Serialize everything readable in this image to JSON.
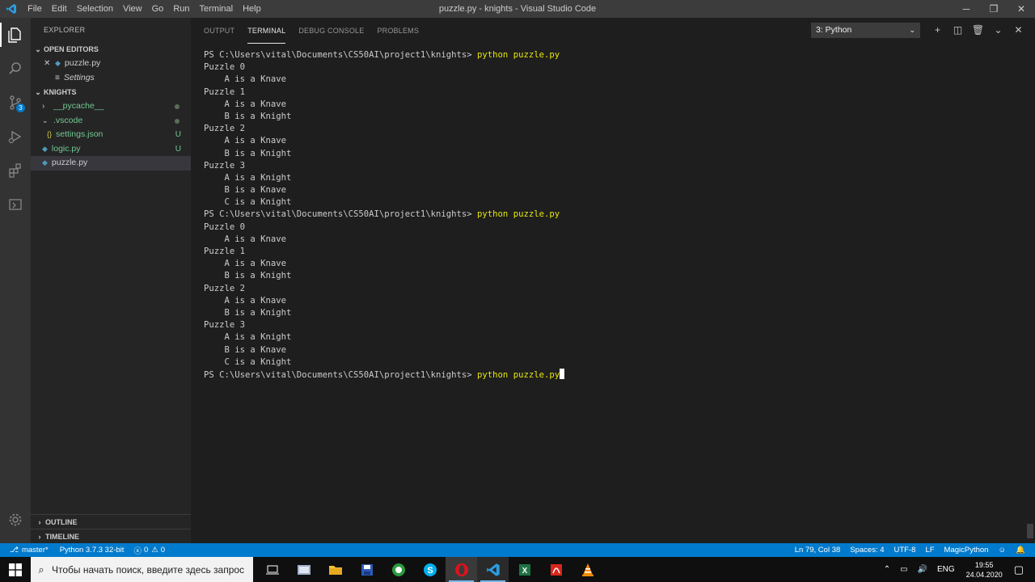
{
  "titlebar": {
    "menu": [
      "File",
      "Edit",
      "Selection",
      "View",
      "Go",
      "Run",
      "Terminal",
      "Help"
    ],
    "title": "puzzle.py - knights - Visual Studio Code",
    "minimize": "─",
    "restore": "❐",
    "close": "✕"
  },
  "activitybar": {
    "scm_badge": "3"
  },
  "sidebar": {
    "header": "EXPLORER",
    "open_editors_label": "OPEN EDITORS",
    "open_editors": [
      {
        "name": "puzzle.py",
        "icon": "python-file-icon"
      },
      {
        "name": "Settings",
        "icon": "settings-icon"
      }
    ],
    "folder_label": "KNIGHTS",
    "tree": [
      {
        "name": "__pycache__",
        "kind": "folder",
        "status": ""
      },
      {
        "name": ".vscode",
        "kind": "folder",
        "status": ""
      },
      {
        "name": "settings.json",
        "kind": "json",
        "status": "U"
      },
      {
        "name": "logic.py",
        "kind": "python",
        "status": "U"
      },
      {
        "name": "puzzle.py",
        "kind": "python",
        "status": ""
      }
    ],
    "outline_label": "OUTLINE",
    "timeline_label": "TIMELINE"
  },
  "panel": {
    "tabs": [
      "OUTPUT",
      "TERMINAL",
      "DEBUG CONSOLE",
      "PROBLEMS"
    ],
    "active_tab": "TERMINAL",
    "terminal_select": "3: Python",
    "prompt": "PS C:\\Users\\vital\\Documents\\CS50AI\\project1\\knights> ",
    "command": "python puzzle.py",
    "output_lines": [
      "Puzzle 0",
      "    A is a Knave",
      "Puzzle 1",
      "    A is a Knave",
      "    B is a Knight",
      "Puzzle 2",
      "    A is a Knave",
      "    B is a Knight",
      "Puzzle 3",
      "    A is a Knight",
      "    B is a Knave",
      "    C is a Knight"
    ]
  },
  "statusbar": {
    "branch": "master*",
    "interpreter": "Python 3.7.3 32-bit",
    "errors": "0",
    "warnings": "0",
    "position": "Ln 79, Col 38",
    "spaces": "Spaces: 4",
    "encoding": "UTF-8",
    "eol": "LF",
    "language": "MagicPython"
  },
  "taskbar": {
    "search_placeholder": "Чтобы начать поиск, введите здесь запрос",
    "language": "ENG",
    "time": "19:55",
    "date": "24.04.2020"
  },
  "colors": {
    "accent": "#007acc",
    "terminal_command": "#e5e510",
    "untracked": "#73c991"
  }
}
